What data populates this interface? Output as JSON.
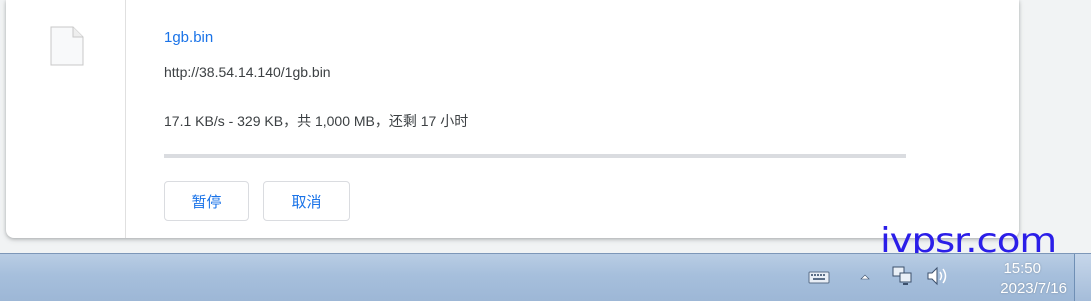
{
  "download": {
    "file_name": "1gb.bin",
    "url": "http://38.54.14.140/1gb.bin",
    "status": "17.1 KB/s - 329 KB，共 1,000 MB，还剩 17 小时",
    "progress_fraction": 0.0,
    "pause_label": "暂停",
    "cancel_label": "取消",
    "file_icon": "file-icon"
  },
  "watermark": {
    "text": "ivpsr.com",
    "color": "#2b1ee8"
  },
  "taskbar": {
    "tray_icons": [
      "keyboard-icon",
      "show-hidden-icons-arrow",
      "network-icon",
      "volume-icon"
    ],
    "time": "15:50",
    "date": "2023/7/16"
  },
  "colors": {
    "accent": "#1a73e8",
    "track": "#dadce0",
    "taskbar": "#a6bfdc"
  }
}
